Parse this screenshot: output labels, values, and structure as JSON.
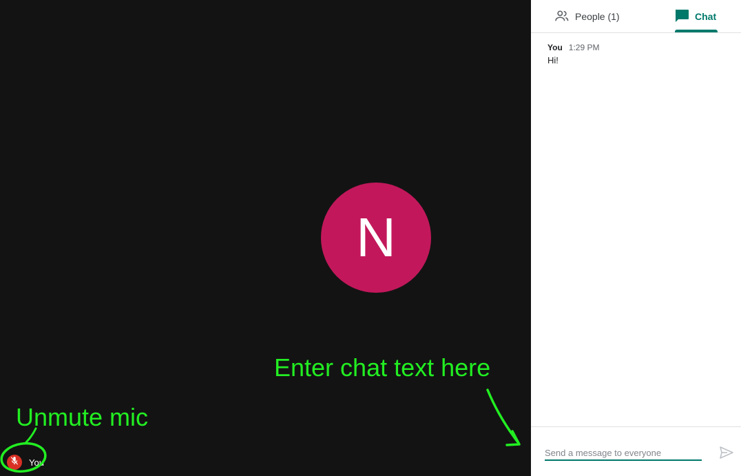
{
  "colors": {
    "accent": "#00796b",
    "avatar_bg": "#c2185b",
    "mic_muted": "#d93025",
    "annotation": "#22ee22"
  },
  "video": {
    "avatar_initial": "N",
    "self_label": "You",
    "mic_icon": "mic-off-icon"
  },
  "annotations": {
    "chat_hint": "Enter chat text here",
    "mic_hint": "Unmute mic"
  },
  "panel": {
    "tabs": [
      {
        "label": "People (1)",
        "icon": "people-icon"
      },
      {
        "label": "Chat",
        "icon": "chat-icon"
      }
    ],
    "messages": [
      {
        "sender": "You",
        "time": "1:29 PM",
        "text": "Hi!"
      }
    ],
    "composer": {
      "placeholder": "Send a message to everyone",
      "value": "",
      "send_icon": "send-icon"
    }
  }
}
